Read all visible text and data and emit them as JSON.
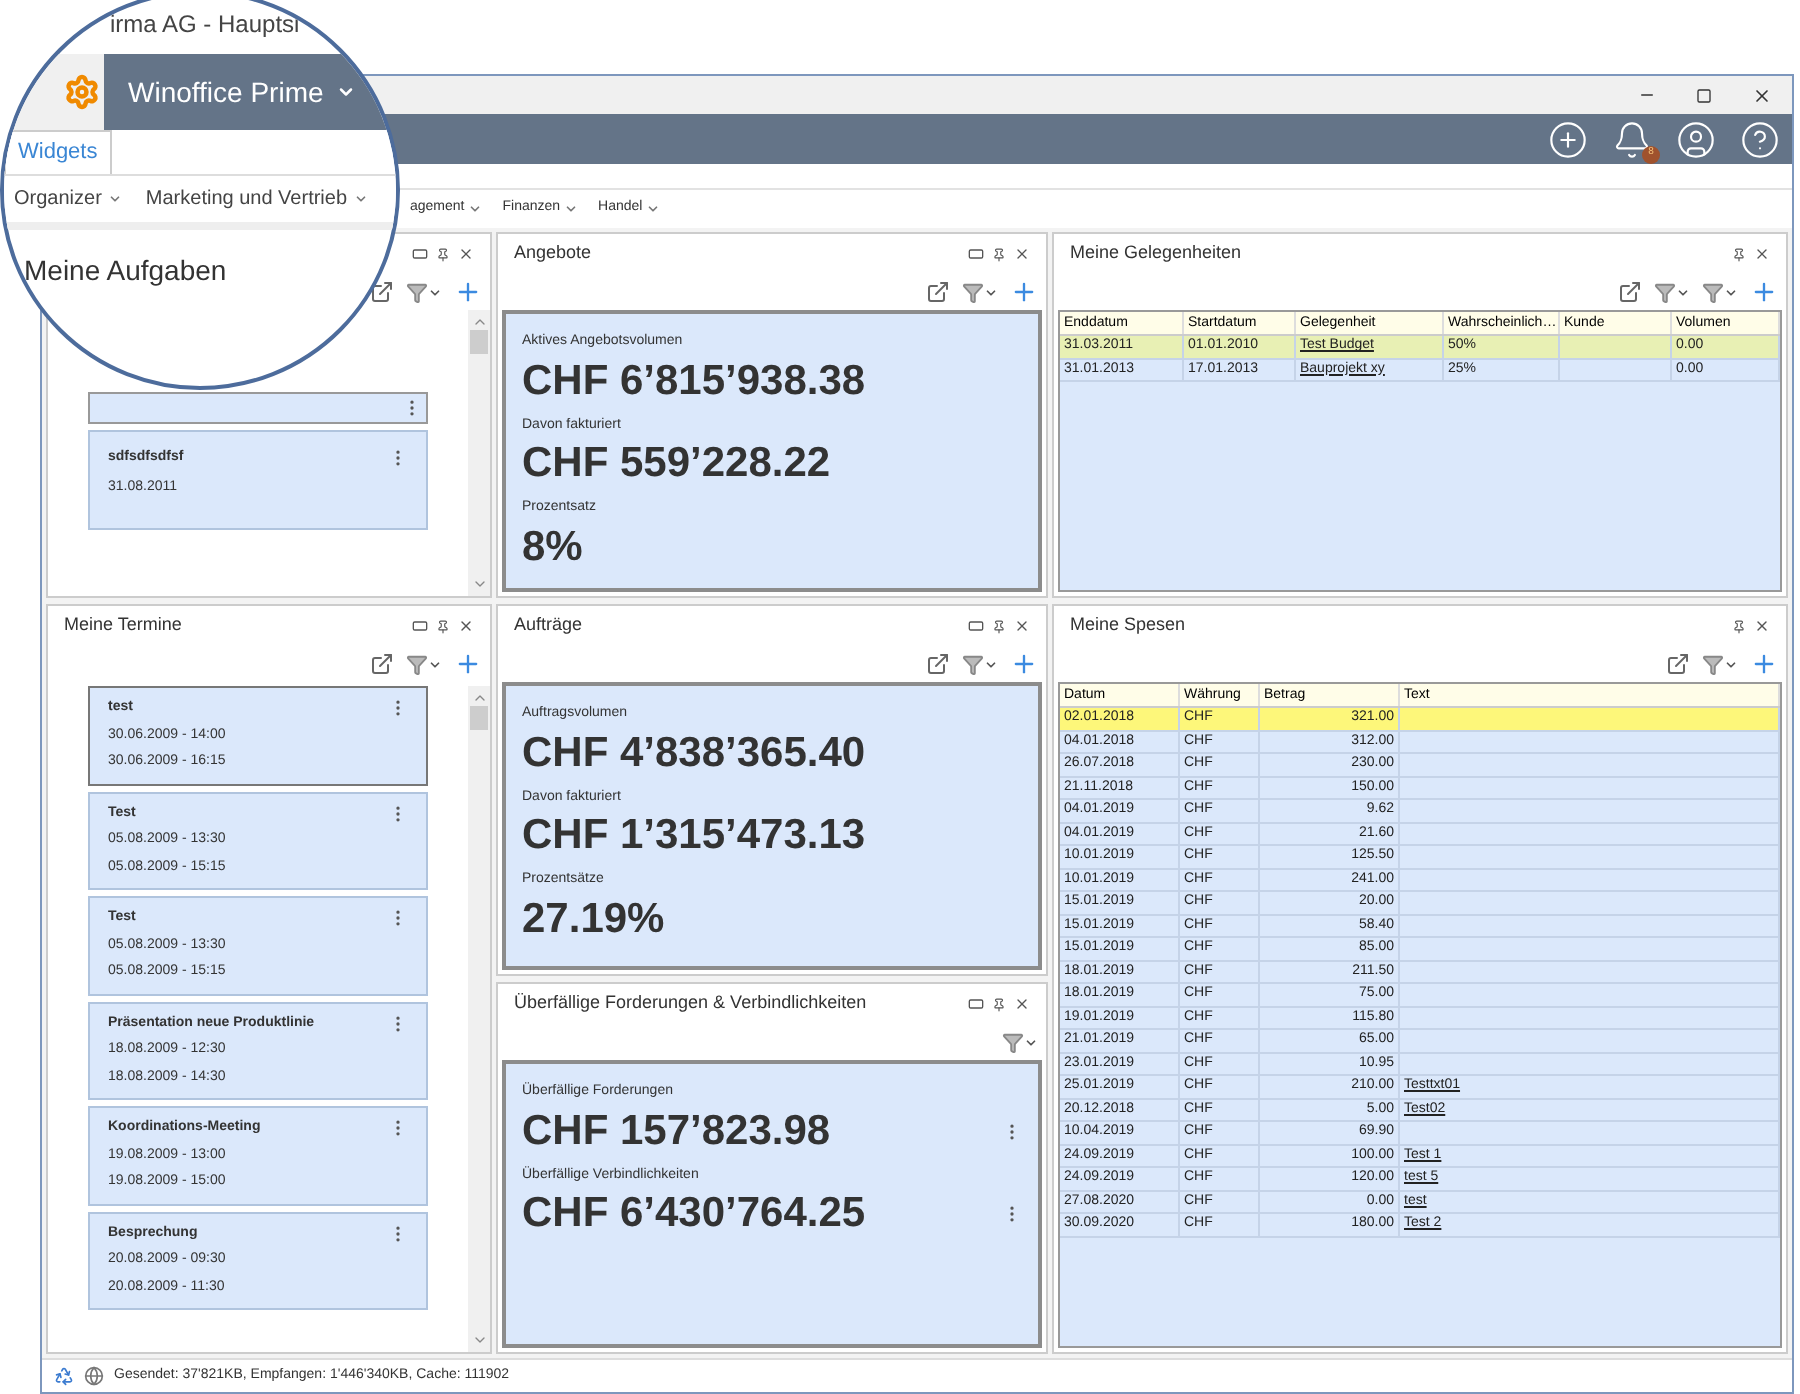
{
  "magnifier": {
    "window_title": "irma AG - Hauptsi",
    "app_name": "Winoffice Prime",
    "tabs": [
      {
        "label": "Widgets",
        "selected": true
      }
    ],
    "menu": [
      "Organizer",
      "Marketing und Vertrieb"
    ],
    "panel_title": "Meine Aufgaben"
  },
  "notifications": {
    "badge": "8"
  },
  "menu": [
    "agement",
    "Finanzen",
    "Handel"
  ],
  "aufgaben": {
    "cards": [
      {
        "selected": false
      },
      {
        "title": "sdfsdfsdfsf",
        "date": "31.08.2011",
        "selected": false
      }
    ]
  },
  "termine": {
    "title": "Meine Termine",
    "cards": [
      {
        "title": "test",
        "start": "30.06.2009 - 14:00",
        "end": "30.06.2009 - 16:15",
        "selected": true
      },
      {
        "title": "Test",
        "start": "05.08.2009 - 13:30",
        "end": "05.08.2009 - 15:15",
        "selected": false
      },
      {
        "title": "Test",
        "start": "05.08.2009 - 13:30",
        "end": "05.08.2009 - 15:15",
        "selected": false
      },
      {
        "title": "Präsentation neue Produktlinie",
        "start": "18.08.2009 - 12:30",
        "end": "18.08.2009 - 14:30",
        "selected": false
      },
      {
        "title": "Koordinations-Meeting",
        "start": "19.08.2009 - 13:00",
        "end": "19.08.2009 - 15:00",
        "selected": false
      },
      {
        "title": "Besprechung",
        "start": "20.08.2009 - 09:30",
        "end": "20.08.2009 - 11:30",
        "selected": false
      }
    ]
  },
  "angebote": {
    "title": "Angebote",
    "metrics": [
      {
        "label": "Aktives Angebotsvolumen",
        "value": "CHF 6’815’938.38"
      },
      {
        "label": "Davon fakturiert",
        "value": "CHF 559’228.22"
      },
      {
        "label": "Prozentsatz",
        "value": "8%"
      }
    ]
  },
  "auftraege": {
    "title": "Aufträge",
    "metrics": [
      {
        "label": "Auftragsvolumen",
        "value": "CHF 4’838’365.40"
      },
      {
        "label": "Davon fakturiert",
        "value": "CHF 1’315’473.13"
      },
      {
        "label": "Prozentsätze",
        "value": "27.19%"
      }
    ]
  },
  "ueberfaellig": {
    "title": "Überfällige Forderungen & Verbindlichkeiten",
    "metrics": [
      {
        "label": "Überfällige Forderungen",
        "value": "CHF 157’823.98"
      },
      {
        "label": "Überfällige Verbindlichkeiten",
        "value": "CHF 6’430’764.25"
      }
    ]
  },
  "gelegenheiten": {
    "title": "Meine Gelegenheiten",
    "columns": [
      {
        "label": "Enddatum",
        "kind": "text"
      },
      {
        "label": "Startdatum",
        "kind": "text"
      },
      {
        "label": "Gelegenheit",
        "kind": "link"
      },
      {
        "label": "Wahrscheinlich…",
        "kind": "text"
      },
      {
        "label": "Kunde",
        "kind": "text"
      },
      {
        "label": "Volumen",
        "kind": "text"
      }
    ],
    "rows": [
      {
        "cells": [
          "31.03.2011",
          "01.01.2010",
          "Test Budget",
          "50%",
          "",
          "0.00"
        ],
        "selected": true
      },
      {
        "cells": [
          "31.01.2013",
          "17.01.2013",
          "Bauprojekt xy",
          "25%",
          "",
          "0.00"
        ],
        "selected": false
      }
    ]
  },
  "spesen": {
    "title": "Meine Spesen",
    "columns": [
      {
        "label": "Datum",
        "kind": "text"
      },
      {
        "label": "Währung",
        "kind": "text"
      },
      {
        "label": "Betrag",
        "kind": "amount"
      },
      {
        "label": "Text",
        "kind": "link"
      }
    ],
    "rows": [
      {
        "cells": [
          "02.01.2018",
          "CHF",
          "321.00",
          ""
        ],
        "selected": true
      },
      {
        "cells": [
          "04.01.2018",
          "CHF",
          "312.00",
          ""
        ],
        "selected": false
      },
      {
        "cells": [
          "26.07.2018",
          "CHF",
          "230.00",
          ""
        ],
        "selected": false
      },
      {
        "cells": [
          "21.11.2018",
          "CHF",
          "150.00",
          ""
        ],
        "selected": false
      },
      {
        "cells": [
          "04.01.2019",
          "CHF",
          "9.62",
          ""
        ],
        "selected": false
      },
      {
        "cells": [
          "04.01.2019",
          "CHF",
          "21.60",
          ""
        ],
        "selected": false
      },
      {
        "cells": [
          "10.01.2019",
          "CHF",
          "125.50",
          ""
        ],
        "selected": false
      },
      {
        "cells": [
          "10.01.2019",
          "CHF",
          "241.00",
          ""
        ],
        "selected": false
      },
      {
        "cells": [
          "15.01.2019",
          "CHF",
          "20.00",
          ""
        ],
        "selected": false
      },
      {
        "cells": [
          "15.01.2019",
          "CHF",
          "58.40",
          ""
        ],
        "selected": false
      },
      {
        "cells": [
          "15.01.2019",
          "CHF",
          "85.00",
          ""
        ],
        "selected": false
      },
      {
        "cells": [
          "18.01.2019",
          "CHF",
          "211.50",
          ""
        ],
        "selected": false
      },
      {
        "cells": [
          "18.01.2019",
          "CHF",
          "75.00",
          ""
        ],
        "selected": false
      },
      {
        "cells": [
          "19.01.2019",
          "CHF",
          "115.80",
          ""
        ],
        "selected": false
      },
      {
        "cells": [
          "21.01.2019",
          "CHF",
          "65.00",
          ""
        ],
        "selected": false
      },
      {
        "cells": [
          "23.01.2019",
          "CHF",
          "10.95",
          ""
        ],
        "selected": false
      },
      {
        "cells": [
          "25.01.2019",
          "CHF",
          "210.00",
          "Testtxt01"
        ],
        "selected": false
      },
      {
        "cells": [
          "20.12.2018",
          "CHF",
          "5.00",
          "Test02"
        ],
        "selected": false
      },
      {
        "cells": [
          "10.04.2019",
          "CHF",
          "69.90",
          ""
        ],
        "selected": false
      },
      {
        "cells": [
          "24.09.2019",
          "CHF",
          "100.00",
          "Test 1"
        ],
        "selected": false
      },
      {
        "cells": [
          "24.09.2019",
          "CHF",
          "120.00",
          "test 5"
        ],
        "selected": false
      },
      {
        "cells": [
          "27.08.2020",
          "CHF",
          "0.00",
          "test"
        ],
        "selected": false
      },
      {
        "cells": [
          "30.09.2020",
          "CHF",
          "180.00",
          "Test 2"
        ],
        "selected": false
      }
    ]
  },
  "status_bar": {
    "text": "Gesendet: 37'821KB, Empfangen: 1'446'340KB, Cache: 111902"
  }
}
